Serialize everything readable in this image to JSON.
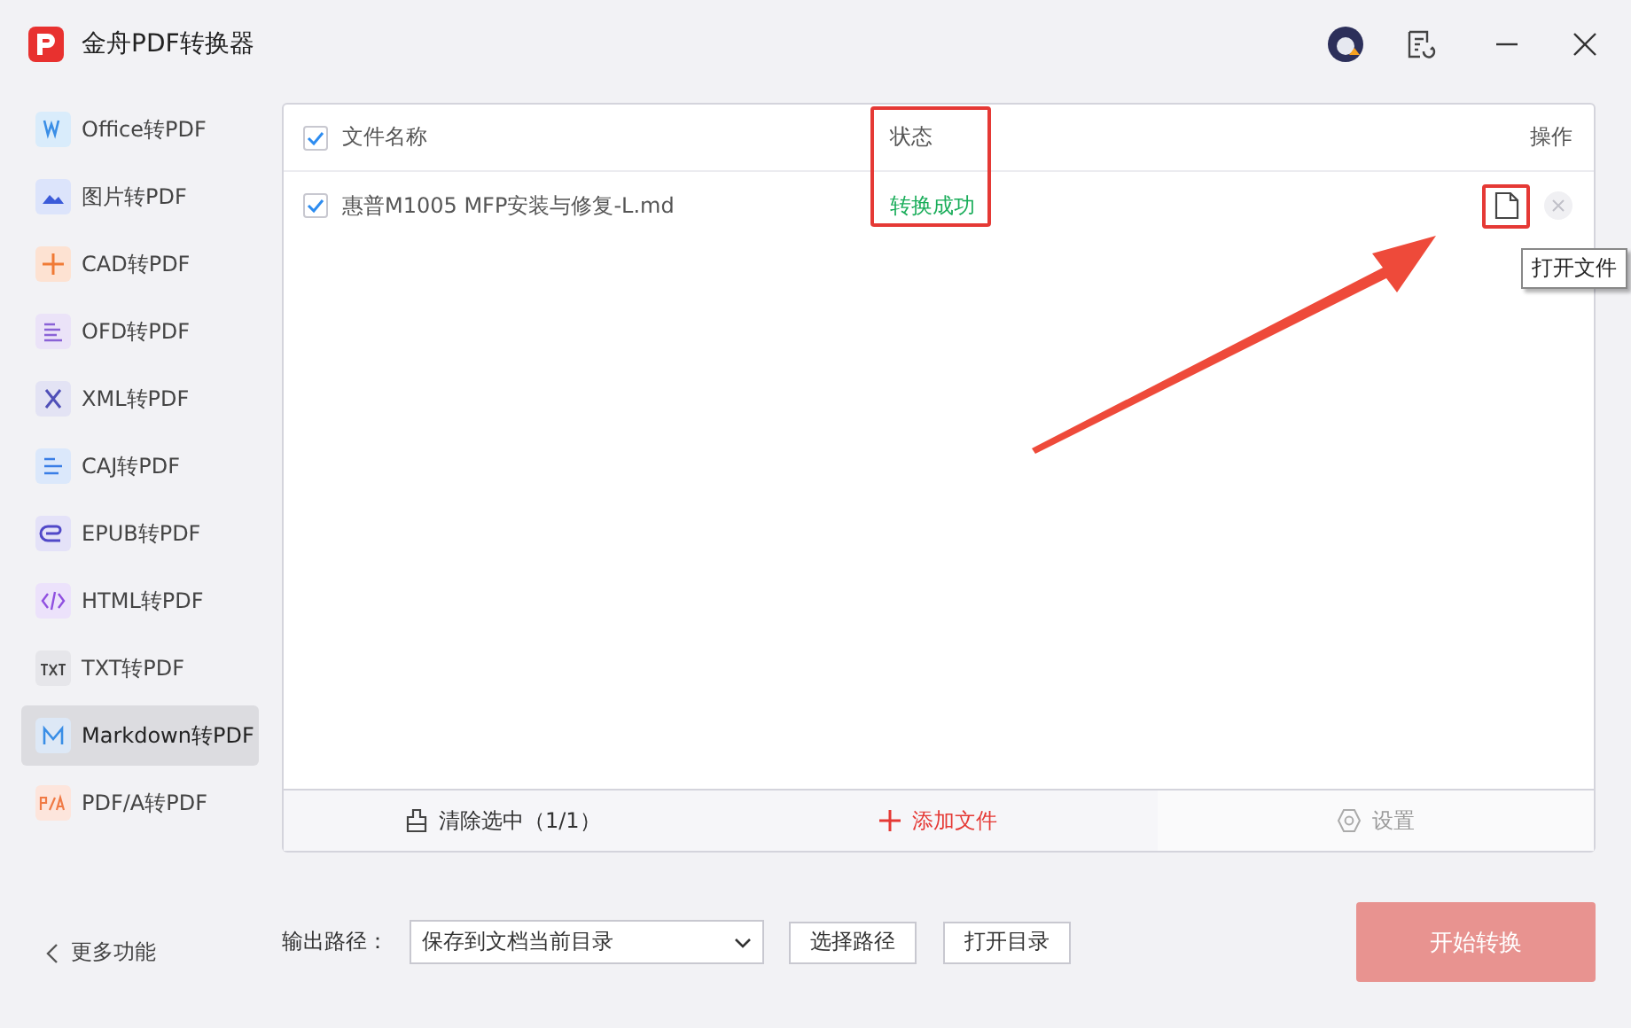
{
  "window": {
    "title": "金舟PDF转换器"
  },
  "sidebar": {
    "items": [
      {
        "label": "Office转PDF",
        "kind": "office",
        "selected": false
      },
      {
        "label": "图片转PDF",
        "kind": "image",
        "selected": false
      },
      {
        "label": "CAD转PDF",
        "kind": "cad",
        "selected": false
      },
      {
        "label": "OFD转PDF",
        "kind": "ofd",
        "selected": false
      },
      {
        "label": "XML转PDF",
        "kind": "xml",
        "selected": false
      },
      {
        "label": "CAJ转PDF",
        "kind": "caj",
        "selected": false
      },
      {
        "label": "EPUB转PDF",
        "kind": "epub",
        "selected": false
      },
      {
        "label": "HTML转PDF",
        "kind": "html",
        "selected": false
      },
      {
        "label": "TXT转PDF",
        "kind": "txt",
        "selected": false
      },
      {
        "label": "Markdown转PDF",
        "kind": "markdown",
        "selected": true
      },
      {
        "label": "PDF/A转PDF",
        "kind": "pdfa",
        "selected": false
      }
    ],
    "more": "更多功能"
  },
  "table": {
    "columns": [
      "文件名称",
      "状态",
      "操作"
    ],
    "header_checked": true,
    "rows": [
      {
        "name": "惠普M1005 MFP安装与修复-L.md",
        "checked": true,
        "status": "转换成功"
      }
    ]
  },
  "tooltip": "打开文件",
  "footer": {
    "clear": "清除选中（1/1）",
    "add": "添加文件",
    "settings": "设置"
  },
  "output": {
    "label": "输出路径：",
    "value": "保存到文档当前目录",
    "choose": "选择路径",
    "open": "打开目录"
  },
  "start_button": "开始转换"
}
